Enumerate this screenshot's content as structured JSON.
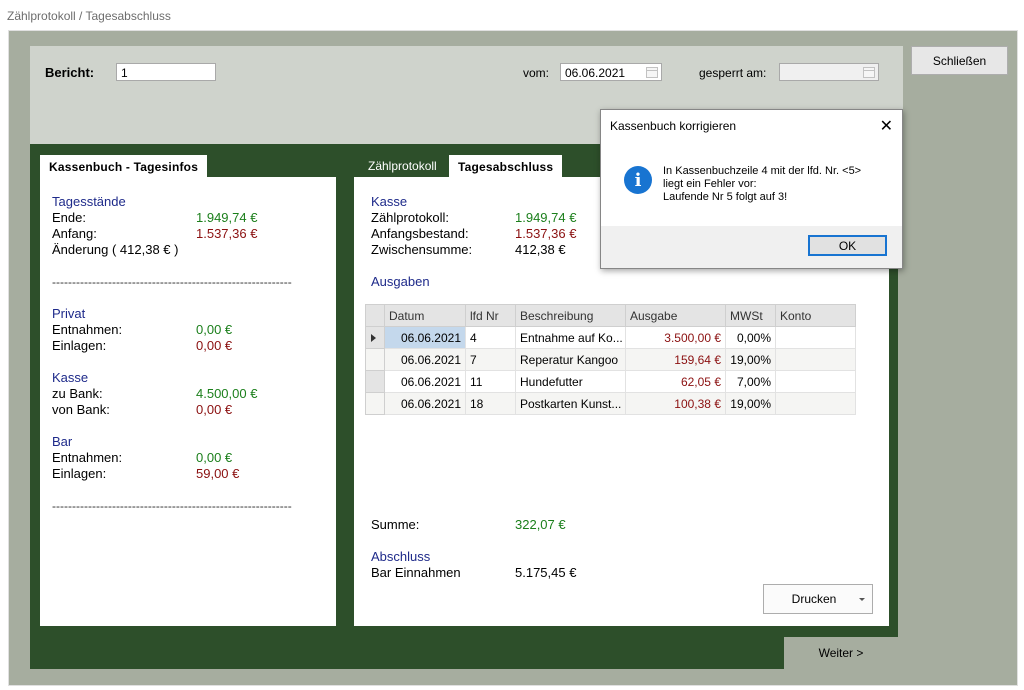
{
  "window": {
    "title": "Zählprotokoll / Tagesabschluss"
  },
  "header": {
    "bericht_label": "Bericht:",
    "bericht_value": "1",
    "vom_label": "vom:",
    "vom_value": "06.06.2021",
    "gesperrt_label": "gesperrt am:",
    "gesperrt_value": "",
    "close_label": "Schließen"
  },
  "left_panel": {
    "tab": "Kassenbuch - Tagesinfos",
    "tagesstaende": {
      "title": "Tagesstände",
      "ende_label": "Ende:",
      "ende_value": "1.949,74 €",
      "anfang_label": "Anfang:",
      "anfang_value": "1.537,36 €",
      "aenderung": "Änderung ( 412,38 € )"
    },
    "separator": "--------------------------------------------------------------------",
    "privat": {
      "title": "Privat",
      "entnahmen_label": "Entnahmen:",
      "entnahmen_value": "0,00 €",
      "einlagen_label": "Einlagen:",
      "einlagen_value": "0,00 €"
    },
    "kasse": {
      "title": "Kasse",
      "zubank_label": "zu Bank:",
      "zubank_value": "4.500,00 €",
      "vonbank_label": "von Bank:",
      "vonbank_value": "0,00 €"
    },
    "bar": {
      "title": "Bar",
      "entnahmen_label": "Entnahmen:",
      "entnahmen_value": "0,00 €",
      "einlagen_label": "Einlagen:",
      "einlagen_value": "59,00 €"
    }
  },
  "right_panel": {
    "tabs": [
      "Zählprotokoll",
      "Tagesabschluss"
    ],
    "kasse": {
      "title": "Kasse",
      "zaehl_label": "Zählprotokoll:",
      "zaehl_value": "1.949,74 €",
      "anfang_label": "Anfangsbestand:",
      "anfang_value": "1.537,36 €",
      "zwischen_label": "Zwischensumme:",
      "zwischen_value": "412,38 €"
    },
    "ausgaben_title": "Ausgaben",
    "table": {
      "columns": [
        "Datum",
        "lfd Nr",
        "Beschreibung",
        "Ausgabe",
        "MWSt",
        "Konto"
      ],
      "rows": [
        [
          "06.06.2021",
          "4",
          "Entnahme auf Ko...",
          "3.500,00 €",
          "0,00%",
          ""
        ],
        [
          "06.06.2021",
          "7",
          "Reperatur Kangoo",
          "159,64 €",
          "19,00%",
          ""
        ],
        [
          "06.06.2021",
          "11",
          "Hundefutter",
          "62,05 €",
          "7,00%",
          ""
        ],
        [
          "06.06.2021",
          "18",
          "Postkarten Kunst...",
          "100,38 €",
          "19,00%",
          ""
        ]
      ]
    },
    "summe_label": "Summe:",
    "summe_value": "322,07 €",
    "abschluss_title": "Abschluss",
    "bar_einnahmen_label": "Bar Einnahmen",
    "bar_einnahmen_value": "5.175,45 €",
    "drucken_label": "Drucken"
  },
  "weiter_label": "Weiter >",
  "dialog": {
    "title": "Kassenbuch korrigieren",
    "message_line1": "In Kassenbuchzeile 4 mit der lfd. Nr. <5>",
    "message_line2": "liegt ein Fehler vor:",
    "message_line3": "Laufende Nr 5 folgt auf 3!",
    "ok_label": "OK"
  },
  "colors": {
    "dark_green": "#2d4f2a",
    "value_green": "#1b7f1b",
    "value_red": "#8b1010",
    "section_blue": "#1e2a8a",
    "accent_blue": "#1874d1"
  }
}
